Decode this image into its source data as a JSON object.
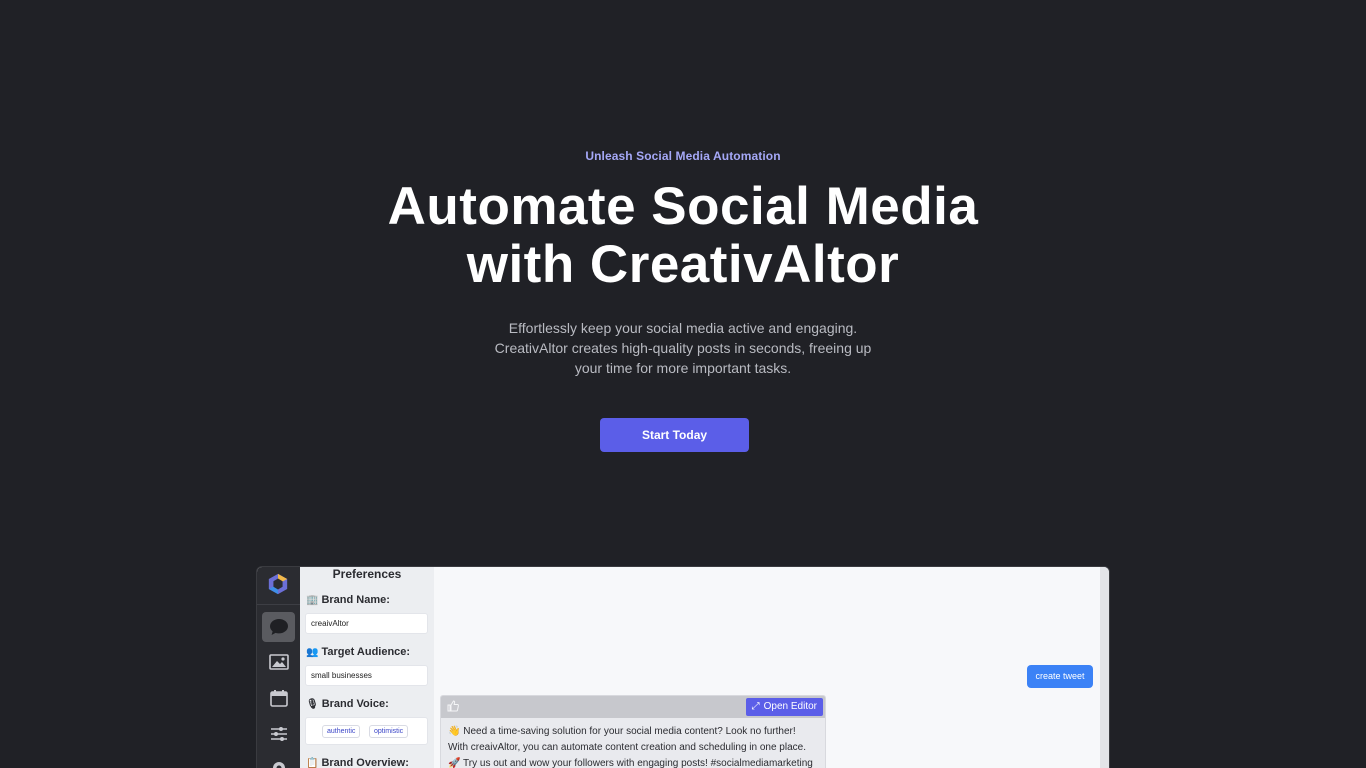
{
  "hero": {
    "eyebrow": "Unleash Social Media Automation",
    "headline_line1": "Automate Social Media",
    "headline_line2": "with CreativAltor",
    "subtitle": "Effortlessly keep your social media active and engaging. CreativAltor creates high-quality posts in seconds, freeing up your time for more important tasks.",
    "cta_label": "Start Today"
  },
  "preview": {
    "sidebar_icons": [
      "logo-icon",
      "chat-icon",
      "image-icon",
      "calendar-icon",
      "sliders-icon",
      "gear-icon"
    ],
    "preferences": {
      "title": "Preferences",
      "brand_name_label": "Brand Name:",
      "brand_name_value": "creaivAltor",
      "target_audience_label": "Target Audience:",
      "target_audience_value": "small businesses",
      "brand_voice_label": "Brand Voice:",
      "brand_voice_tags": [
        "authentic",
        "optimistic"
      ],
      "brand_overview_label": "Brand Overview:"
    },
    "create_tweet_label": "create tweet",
    "tweet_card": {
      "open_editor_label": "Open Editor",
      "line1": "👋 Need a time-saving solution for your social media content? Look no further!",
      "line2": "With creaivAltor, you can automate content creation and scheduling in one place.",
      "line3": "🚀 Try us out and wow your followers with engaging posts! #socialmediamarketing"
    }
  },
  "colors": {
    "background": "#202126",
    "accent": "#5b5ee8",
    "eyebrow": "#a5a8f7",
    "tweet_button": "#3b82f6"
  }
}
